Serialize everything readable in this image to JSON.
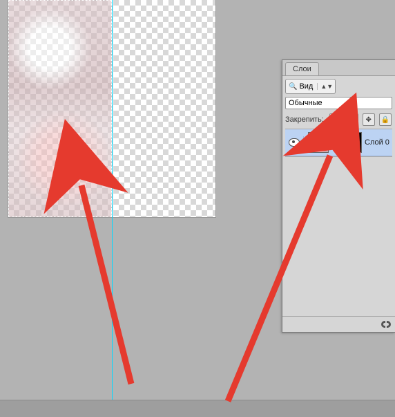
{
  "panel": {
    "tab_label": "Слои",
    "filter_label": "Вид",
    "blend_mode": "Обычные",
    "lock_label": "Закрепить:",
    "lock_buttons": [
      "transparency",
      "pixels",
      "position",
      "all"
    ]
  },
  "layer": {
    "name": "Слой 0",
    "visible": true,
    "linked": true
  },
  "colors": {
    "selection_highlight": "#bcd3f3",
    "annotation_arrow": "#e53a2e",
    "guide": "#00d9ff"
  }
}
